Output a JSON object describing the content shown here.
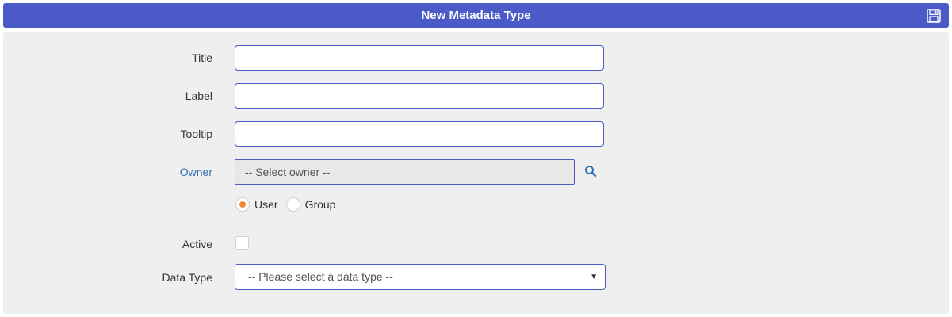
{
  "header": {
    "title": "New Metadata Type",
    "save_icon": "floppy-disk-icon"
  },
  "form": {
    "title_label": "Title",
    "title_value": "",
    "label_label": "Label",
    "label_value": "",
    "tooltip_label": "Tooltip",
    "tooltip_value": "",
    "owner_label": "Owner",
    "owner_select": "-- Select owner --",
    "owner_search_icon": "search-icon",
    "owner_type_options": [
      "User",
      "Group"
    ],
    "owner_type_selected": "User",
    "active_label": "Active",
    "active_checked": false,
    "data_type_label": "Data Type",
    "data_type_selected": "-- Please select a data type --"
  },
  "colors": {
    "header_bg": "#4a5bc7",
    "panel_bg": "#efefef",
    "link": "#2f6fb3",
    "radio_selected": "#f28b30"
  }
}
